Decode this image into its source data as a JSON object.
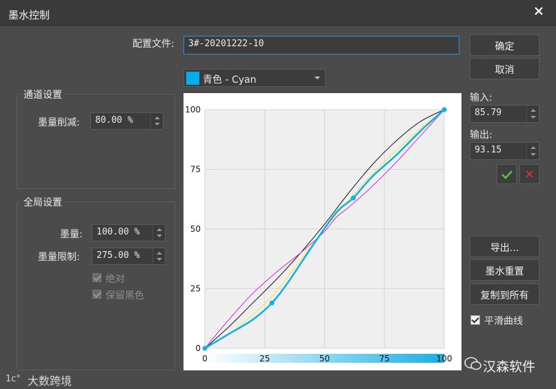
{
  "window": {
    "title": "墨水控制"
  },
  "profile": {
    "label": "配置文件:",
    "value": "3#-20201222-10"
  },
  "buttons": {
    "ok": "确定",
    "cancel": "取消",
    "export": "导出...",
    "reset": "墨水重置",
    "copy_all": "复制到所有",
    "smooth": "平滑曲线"
  },
  "channel_group": {
    "title": "通道设置",
    "reduce_label": "墨量削减:",
    "reduce_value": "80.00 %"
  },
  "global_group": {
    "title": "全局设置",
    "ink_label": "墨量:",
    "ink_value": "100.00 %",
    "limit_label": "墨量限制:",
    "limit_value": "275.00 %",
    "absolute_label": "绝对",
    "keep_black_label": "保留黑色"
  },
  "channel_select": {
    "label": "青色 - Cyan",
    "color": "#00aeef"
  },
  "io": {
    "input_label": "输入:",
    "input_value": "85.79",
    "output_label": "输出:",
    "output_value": "93.15"
  },
  "colors": {
    "accent": "#1aaee6",
    "magenta": "#d43ad4",
    "yellow": "#f0e84a",
    "black": "#222222",
    "confirm_green": "#58c341",
    "cancel_red": "#d8322e"
  },
  "watermarks": {
    "left": "大数跨境",
    "right": "汉森软件"
  },
  "chart_data": {
    "type": "line",
    "xlim": [
      0,
      100
    ],
    "ylim": [
      0,
      100
    ],
    "x_ticks": [
      "0",
      "25",
      "50",
      "75",
      "100"
    ],
    "y_ticks": [
      "0",
      "25",
      "50",
      "75",
      "100"
    ],
    "grid": true,
    "series": [
      {
        "color": "black",
        "x": [
          0,
          10,
          20,
          30,
          40,
          50,
          60,
          70,
          80,
          90,
          100
        ],
        "y": [
          0,
          9,
          19,
          29,
          40,
          52,
          65,
          77,
          87,
          95,
          100
        ]
      },
      {
        "color": "magenta",
        "x": [
          0,
          10,
          20,
          30,
          40,
          50,
          55,
          60,
          70,
          80,
          90,
          100
        ],
        "y": [
          0,
          12,
          23,
          32,
          40,
          49,
          55,
          59,
          68,
          78,
          89,
          100
        ]
      },
      {
        "color": "yellow",
        "x": [
          0,
          10,
          20,
          30,
          40,
          50,
          60,
          70,
          80,
          90,
          100
        ],
        "y": [
          0,
          6,
          14,
          24,
          37,
          50,
          62,
          73,
          83,
          92,
          100
        ]
      },
      {
        "color": "cyan",
        "x": [
          0,
          10,
          20,
          28,
          35,
          45,
          55,
          62,
          70,
          80,
          90,
          100
        ],
        "y": [
          0,
          6,
          12,
          19,
          28,
          43,
          57,
          63,
          72,
          81,
          91,
          100
        ],
        "points": [
          [
            0,
            0
          ],
          [
            28,
            19
          ],
          [
            62,
            63
          ],
          [
            100,
            100
          ]
        ]
      }
    ]
  }
}
